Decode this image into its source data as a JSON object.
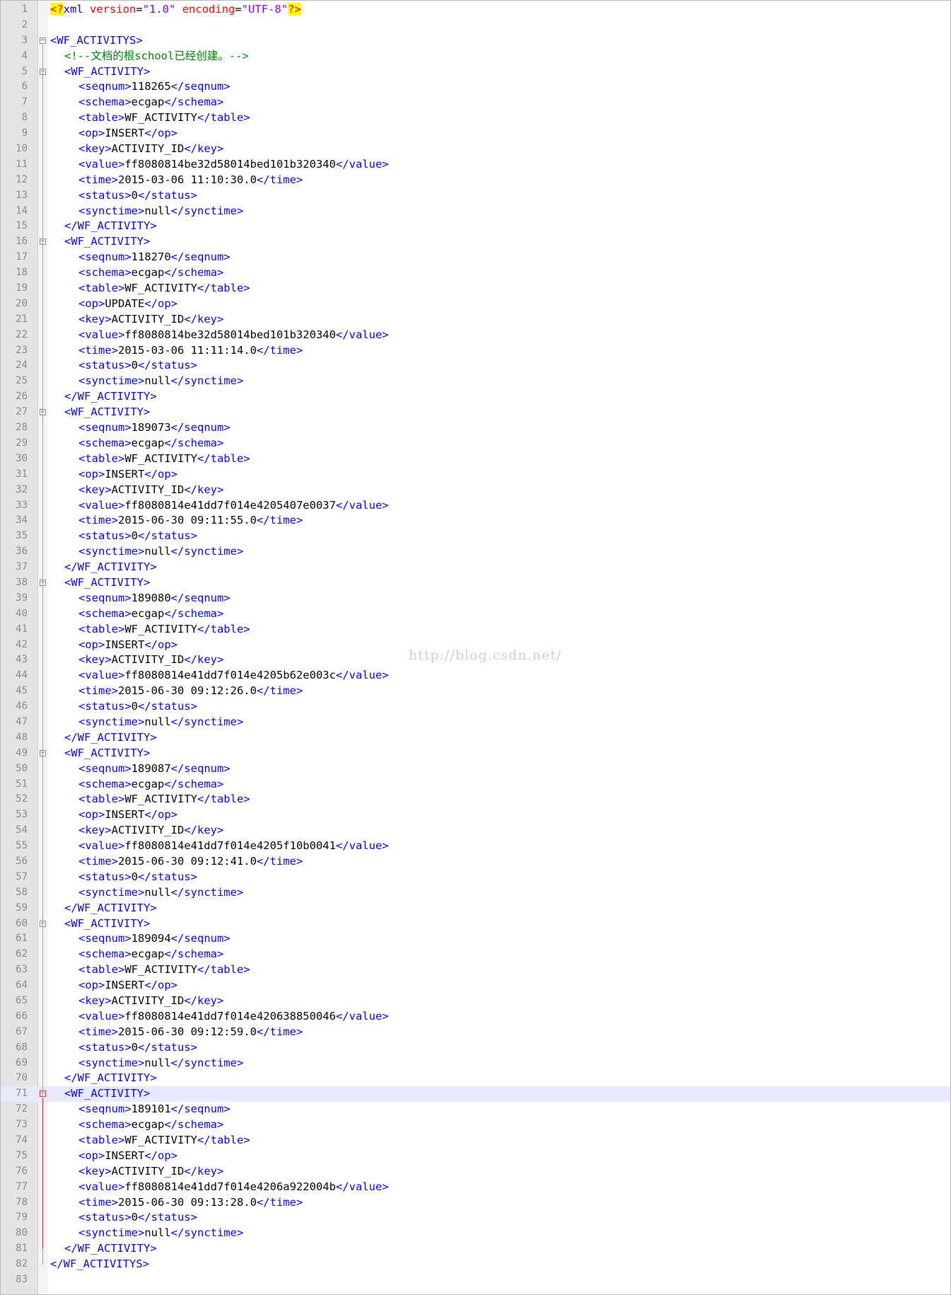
{
  "watermark": "http://blog.csdn.net/",
  "xml_decl": {
    "open": "<?",
    "name": "xml",
    "attrs": [
      {
        "k": "version",
        "v": "\"1.0\""
      },
      {
        "k": "encoding",
        "v": "\"UTF-8\""
      }
    ],
    "close": "?>"
  },
  "root_open": "<WF_ACTIVITYS>",
  "root_close": "</WF_ACTIVITYS>",
  "comment": "<!--文档的根school已经创建。-->",
  "record_open": "<WF_ACTIVITY>",
  "record_close": "</WF_ACTIVITY>",
  "records": [
    {
      "seqnum": "118265",
      "schema": "ecgap",
      "table": "WF_ACTIVITY",
      "op": "INSERT",
      "key": "ACTIVITY_ID",
      "value": "ff8080814be32d58014bed101b320340",
      "time": "2015-03-06 11:10:30.0",
      "status": "0",
      "synctime": "null"
    },
    {
      "seqnum": "118270",
      "schema": "ecgap",
      "table": "WF_ACTIVITY",
      "op": "UPDATE",
      "key": "ACTIVITY_ID",
      "value": "ff8080814be32d58014bed101b320340",
      "time": "2015-03-06 11:11:14.0",
      "status": "0",
      "synctime": "null"
    },
    {
      "seqnum": "189073",
      "schema": "ecgap",
      "table": "WF_ACTIVITY",
      "op": "INSERT",
      "key": "ACTIVITY_ID",
      "value": "ff8080814e41dd7f014e4205407e0037",
      "time": "2015-06-30 09:11:55.0",
      "status": "0",
      "synctime": "null"
    },
    {
      "seqnum": "189080",
      "schema": "ecgap",
      "table": "WF_ACTIVITY",
      "op": "INSERT",
      "key": "ACTIVITY_ID",
      "value": "ff8080814e41dd7f014e4205b62e003c",
      "time": "2015-06-30 09:12:26.0",
      "status": "0",
      "synctime": "null"
    },
    {
      "seqnum": "189087",
      "schema": "ecgap",
      "table": "WF_ACTIVITY",
      "op": "INSERT",
      "key": "ACTIVITY_ID",
      "value": "ff8080814e41dd7f014e4205f10b0041",
      "time": "2015-06-30 09:12:41.0",
      "status": "0",
      "synctime": "null"
    },
    {
      "seqnum": "189094",
      "schema": "ecgap",
      "table": "WF_ACTIVITY",
      "op": "INSERT",
      "key": "ACTIVITY_ID",
      "value": "ff8080814e41dd7f014e420638850046",
      "time": "2015-06-30 09:12:59.0",
      "status": "0",
      "synctime": "null"
    },
    {
      "seqnum": "189101",
      "schema": "ecgap",
      "table": "WF_ACTIVITY",
      "op": "INSERT",
      "key": "ACTIVITY_ID",
      "value": "ff8080814e41dd7f014e4206a922004b",
      "time": "2015-06-30 09:13:28.0",
      "status": "0",
      "synctime": "null"
    }
  ],
  "field_order": [
    "seqnum",
    "schema",
    "table",
    "op",
    "key",
    "value",
    "time",
    "status",
    "synctime"
  ],
  "current_line": 71,
  "colors": {
    "tag": "#0000ff",
    "attr": "#ff0000",
    "attr_value": "#8000ff",
    "comment": "#008000",
    "current_line_bg": "#e8e8ff",
    "decl_highlight": "#ffff00"
  }
}
